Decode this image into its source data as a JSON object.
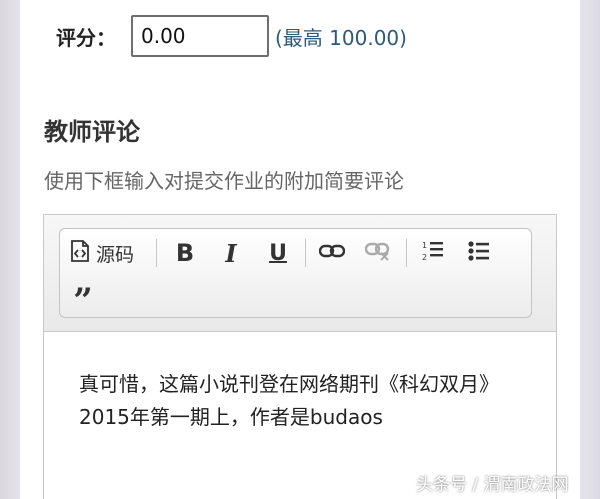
{
  "score": {
    "label": "评分：",
    "value": "0.00",
    "max_text": "(最高 100.00)"
  },
  "comments": {
    "title": "教师评论",
    "description": "使用下框输入对提交作业的附加简要评论"
  },
  "toolbar": {
    "source_label": "源码",
    "buttons": [
      "source-icon",
      "bold-icon",
      "italic-icon",
      "underline-icon",
      "link-icon",
      "unlink-icon",
      "numbered-list-icon",
      "bulleted-list-icon",
      "blockquote-icon"
    ]
  },
  "editor": {
    "content": "真可惜，这篇小说刊登在网络期刊《科幻双月》2015年第一期上，作者是budaos"
  },
  "watermark": "头条号 / 渭南政法网",
  "colors": {
    "max_text": "#2c5a78",
    "title": "#333333",
    "description": "#666666"
  }
}
